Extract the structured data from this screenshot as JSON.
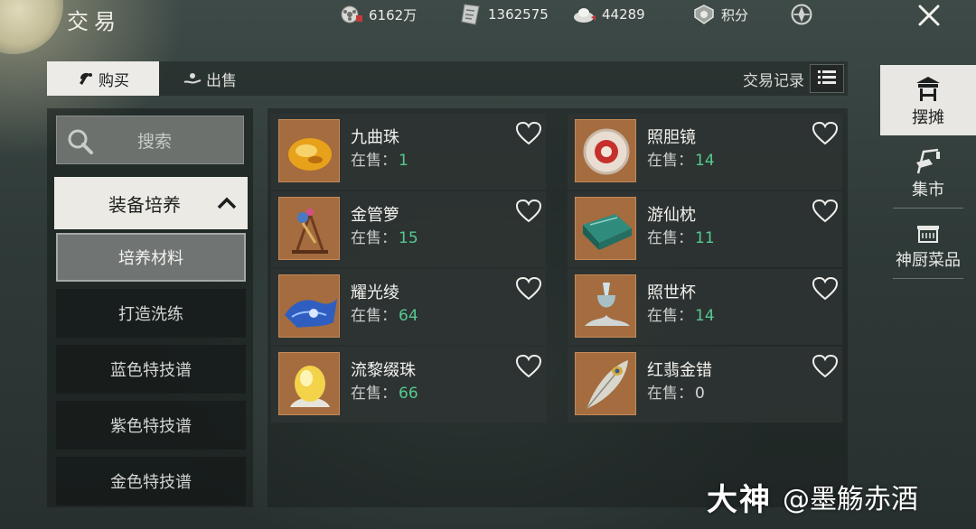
{
  "header": {
    "title": "交易",
    "currencies": [
      {
        "icon": "film-reel-coin-icon",
        "value": "6162万"
      },
      {
        "icon": "silver-note-icon",
        "value": "1362575"
      },
      {
        "icon": "ingot-icon",
        "value": "44289"
      },
      {
        "icon": "badge-icon",
        "value": "积分"
      }
    ],
    "extra_icon": "emblem-icon",
    "close_icon": "close-icon"
  },
  "tabs": [
    {
      "label": "购买",
      "icon": "buy-icon",
      "active": true
    },
    {
      "label": "出售",
      "icon": "sell-icon",
      "active": false
    }
  ],
  "records_label": "交易记录",
  "search": {
    "placeholder": "搜索"
  },
  "category": {
    "label": "装备培养",
    "expanded": true
  },
  "subcategories": [
    {
      "label": "培养材料",
      "selected": true
    },
    {
      "label": "打造洗练",
      "selected": false
    },
    {
      "label": "蓝色特技谱",
      "selected": false
    },
    {
      "label": "紫色特技谱",
      "selected": false
    },
    {
      "label": "金色特技谱",
      "selected": false
    }
  ],
  "sale_label": "在售：",
  "items": [
    {
      "name": "九曲珠",
      "count": "1",
      "icon": "amber-bead-icon"
    },
    {
      "name": "照胆镜",
      "count": "14",
      "icon": "mirror-icon"
    },
    {
      "name": "金管箩",
      "count": "15",
      "icon": "golden-instrument-icon"
    },
    {
      "name": "游仙枕",
      "count": "11",
      "icon": "jade-pillow-icon"
    },
    {
      "name": "耀光绫",
      "count": "64",
      "icon": "silk-cloth-icon"
    },
    {
      "name": "照世杯",
      "count": "14",
      "icon": "crystal-cup-icon"
    },
    {
      "name": "流黎缀珠",
      "count": "66",
      "icon": "glowing-pearl-icon"
    },
    {
      "name": "红翡金错",
      "count": "0",
      "icon": "feather-icon"
    }
  ],
  "right_nav": [
    {
      "label": "摆摊",
      "icon": "stall-icon",
      "active": true
    },
    {
      "label": "集市",
      "icon": "market-icon",
      "active": false
    },
    {
      "label": "神厨菜品",
      "icon": "kitchen-icon",
      "active": false
    }
  ],
  "watermark": {
    "brand": "大神",
    "handle": "@墨觞赤酒"
  },
  "colors": {
    "accent_green": "#57c98f",
    "active_bg": "#ecebe7",
    "thumb_bg": "#a46c3f"
  }
}
